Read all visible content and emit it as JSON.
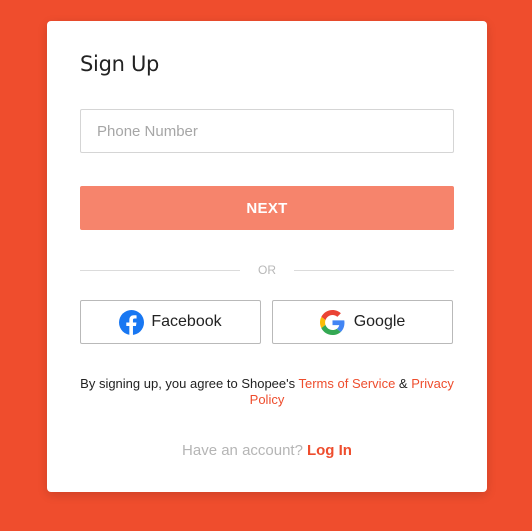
{
  "colors": {
    "background": "#ef4d2d",
    "brand": "#ee4d2d",
    "next_button_bg": "#f6846c",
    "card": "#ffffff"
  },
  "signup": {
    "title": "Sign Up",
    "phone": {
      "placeholder": "Phone Number",
      "value": ""
    },
    "next_label": "NEXT",
    "divider_text": "OR",
    "facebook": {
      "label": "Facebook",
      "icon": "facebook-icon"
    },
    "google": {
      "label": "Google",
      "icon": "google-icon"
    },
    "terms": {
      "prefix": "By signing up, you agree to Shopee's ",
      "terms_link": "Terms of Service",
      "joiner": " & ",
      "privacy_link": "Privacy Policy"
    },
    "login": {
      "prompt": "Have an account?",
      "link": "Log In"
    }
  }
}
